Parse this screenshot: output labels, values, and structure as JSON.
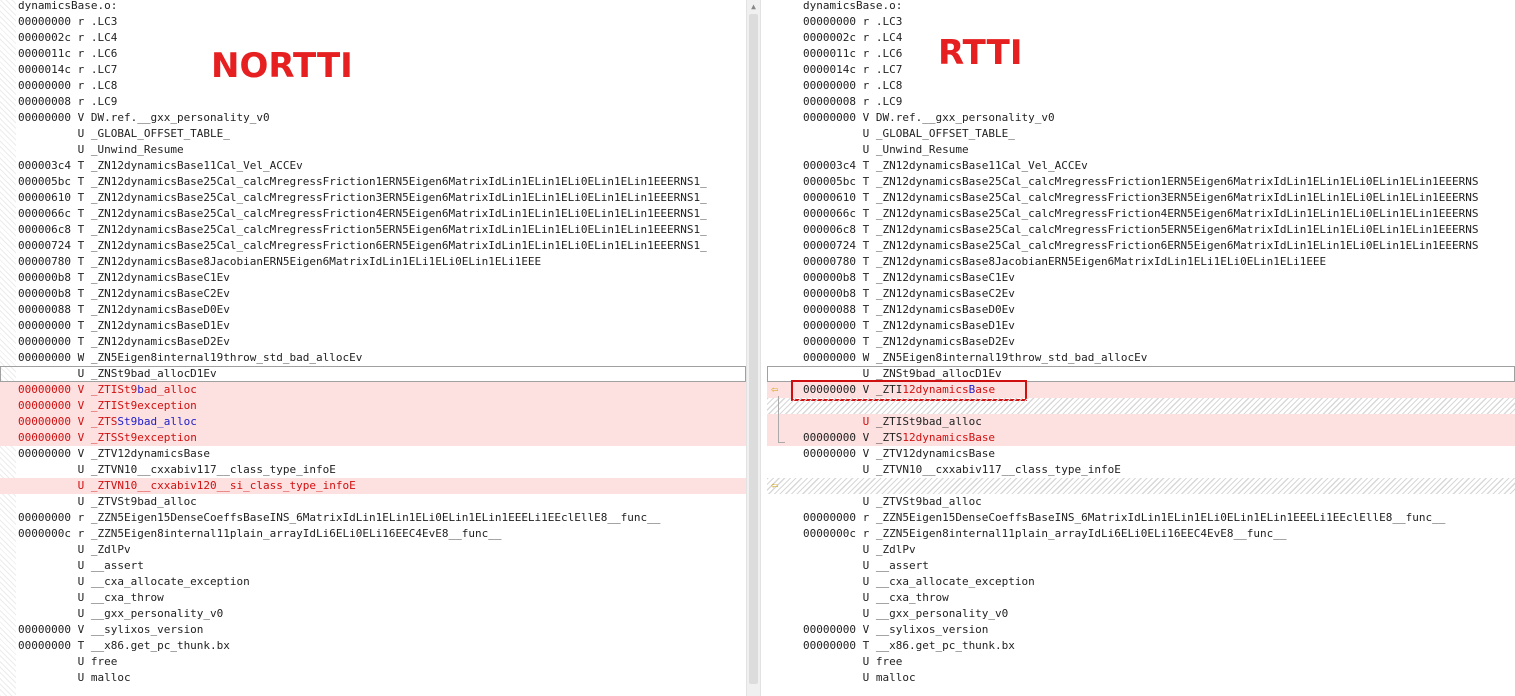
{
  "labels": {
    "left": "NORTTI",
    "right": "RTTI"
  },
  "left_lines": [
    {
      "addr": "dynamicsBase.o:",
      "type": "",
      "sym": "",
      "style": "normal"
    },
    {
      "addr": "00000000",
      "type": "r",
      "sym": ".LC3",
      "style": "normal"
    },
    {
      "addr": "0000002c",
      "type": "r",
      "sym": ".LC4",
      "style": "normal"
    },
    {
      "addr": "0000011c",
      "type": "r",
      "sym": ".LC6",
      "style": "normal"
    },
    {
      "addr": "0000014c",
      "type": "r",
      "sym": ".LC7",
      "style": "normal"
    },
    {
      "addr": "00000000",
      "type": "r",
      "sym": ".LC8",
      "style": "normal"
    },
    {
      "addr": "00000008",
      "type": "r",
      "sym": ".LC9",
      "style": "normal"
    },
    {
      "addr": "00000000",
      "type": "V",
      "sym": "DW.ref.__gxx_personality_v0",
      "style": "normal"
    },
    {
      "addr": "        ",
      "type": "U",
      "sym": "_GLOBAL_OFFSET_TABLE_",
      "style": "normal"
    },
    {
      "addr": "        ",
      "type": "U",
      "sym": "_Unwind_Resume",
      "style": "normal"
    },
    {
      "addr": "000003c4",
      "type": "T",
      "sym": "_ZN12dynamicsBase11Cal_Vel_ACCEv",
      "style": "normal"
    },
    {
      "addr": "000005bc",
      "type": "T",
      "sym": "_ZN12dynamicsBase25Cal_calcMregressFriction1ERN5Eigen6MatrixIdLin1ELin1ELi0ELin1ELin1EEERNS1_",
      "style": "normal"
    },
    {
      "addr": "00000610",
      "type": "T",
      "sym": "_ZN12dynamicsBase25Cal_calcMregressFriction3ERN5Eigen6MatrixIdLin1ELin1ELi0ELin1ELin1EEERNS1_",
      "style": "normal"
    },
    {
      "addr": "0000066c",
      "type": "T",
      "sym": "_ZN12dynamicsBase25Cal_calcMregressFriction4ERN5Eigen6MatrixIdLin1ELin1ELi0ELin1ELin1EEERNS1_",
      "style": "normal"
    },
    {
      "addr": "000006c8",
      "type": "T",
      "sym": "_ZN12dynamicsBase25Cal_calcMregressFriction5ERN5Eigen6MatrixIdLin1ELin1ELi0ELin1ELin1EEERNS1_",
      "style": "normal"
    },
    {
      "addr": "00000724",
      "type": "T",
      "sym": "_ZN12dynamicsBase25Cal_calcMregressFriction6ERN5Eigen6MatrixIdLin1ELin1ELi0ELin1ELin1EEERNS1_",
      "style": "normal"
    },
    {
      "addr": "00000780",
      "type": "T",
      "sym": "_ZN12dynamicsBase8JacobianERN5Eigen6MatrixIdLin1ELi1ELi0ELin1ELi1EEE",
      "style": "normal"
    },
    {
      "addr": "000000b8",
      "type": "T",
      "sym": "_ZN12dynamicsBaseC1Ev",
      "style": "normal"
    },
    {
      "addr": "000000b8",
      "type": "T",
      "sym": "_ZN12dynamicsBaseC2Ev",
      "style": "normal"
    },
    {
      "addr": "00000088",
      "type": "T",
      "sym": "_ZN12dynamicsBaseD0Ev",
      "style": "normal"
    },
    {
      "addr": "00000000",
      "type": "T",
      "sym": "_ZN12dynamicsBaseD1Ev",
      "style": "normal"
    },
    {
      "addr": "00000000",
      "type": "T",
      "sym": "_ZN12dynamicsBaseD2Ev",
      "style": "normal"
    },
    {
      "addr": "00000000",
      "type": "W",
      "sym": "_ZN5Eigen8internal19throw_std_bad_allocEv",
      "style": "normal"
    },
    {
      "addr": "        ",
      "type": "U",
      "sym": "_ZNSt9bad_allocD1Ev",
      "style": "outline"
    },
    {
      "addr": "00000000",
      "type": "V",
      "sym": "_ZTISt9bad_alloc",
      "style": "del"
    },
    {
      "addr": "00000000",
      "type": "V",
      "sym": "_ZTISt9exception",
      "style": "del"
    },
    {
      "addr": "00000000",
      "type": "V",
      "sym": "_ZTSSt9bad_alloc",
      "style": "del"
    },
    {
      "addr": "00000000",
      "type": "V",
      "sym": "_ZTSSt9exception",
      "style": "del"
    },
    {
      "addr": "00000000",
      "type": "V",
      "sym": "_ZTV12dynamicsBase",
      "style": "normal"
    },
    {
      "addr": "        ",
      "type": "U",
      "sym": "_ZTVN10__cxxabiv117__class_type_infoE",
      "style": "normal"
    },
    {
      "addr": "        ",
      "type": "U",
      "sym": "_ZTVN10__cxxabiv120__si_class_type_infoE",
      "style": "del"
    },
    {
      "addr": "        ",
      "type": "U",
      "sym": "_ZTVSt9bad_alloc",
      "style": "normal"
    },
    {
      "addr": "00000000",
      "type": "r",
      "sym": "_ZZN5Eigen15DenseCoeffsBaseINS_6MatrixIdLin1ELin1ELi0ELin1ELin1EEELi1EEclEllE8__func__",
      "style": "normal"
    },
    {
      "addr": "0000000c",
      "type": "r",
      "sym": "_ZZN5Eigen8internal11plain_arrayIdLi6ELi0ELi16EEC4EvE8__func__",
      "style": "normal"
    },
    {
      "addr": "        ",
      "type": "U",
      "sym": "_ZdlPv",
      "style": "normal"
    },
    {
      "addr": "        ",
      "type": "U",
      "sym": "__assert",
      "style": "normal"
    },
    {
      "addr": "        ",
      "type": "U",
      "sym": "__cxa_allocate_exception",
      "style": "normal"
    },
    {
      "addr": "        ",
      "type": "U",
      "sym": "__cxa_throw",
      "style": "normal"
    },
    {
      "addr": "        ",
      "type": "U",
      "sym": "__gxx_personality_v0",
      "style": "normal"
    },
    {
      "addr": "00000000",
      "type": "V",
      "sym": "__sylixos_version",
      "style": "normal"
    },
    {
      "addr": "00000000",
      "type": "T",
      "sym": "__x86.get_pc_thunk.bx",
      "style": "normal"
    },
    {
      "addr": "        ",
      "type": "U",
      "sym": "free",
      "style": "normal"
    },
    {
      "addr": "        ",
      "type": "U",
      "sym": "malloc",
      "style": "normal"
    }
  ],
  "right_lines": [
    {
      "addr": "dynamicsBase.o:",
      "type": "",
      "sym": "",
      "style": "normal"
    },
    {
      "addr": "00000000",
      "type": "r",
      "sym": ".LC3",
      "style": "normal"
    },
    {
      "addr": "0000002c",
      "type": "r",
      "sym": ".LC4",
      "style": "normal"
    },
    {
      "addr": "0000011c",
      "type": "r",
      "sym": ".LC6",
      "style": "normal"
    },
    {
      "addr": "0000014c",
      "type": "r",
      "sym": ".LC7",
      "style": "normal"
    },
    {
      "addr": "00000000",
      "type": "r",
      "sym": ".LC8",
      "style": "normal"
    },
    {
      "addr": "00000008",
      "type": "r",
      "sym": ".LC9",
      "style": "normal"
    },
    {
      "addr": "00000000",
      "type": "V",
      "sym": "DW.ref.__gxx_personality_v0",
      "style": "normal"
    },
    {
      "addr": "        ",
      "type": "U",
      "sym": "_GLOBAL_OFFSET_TABLE_",
      "style": "normal"
    },
    {
      "addr": "        ",
      "type": "U",
      "sym": "_Unwind_Resume",
      "style": "normal"
    },
    {
      "addr": "000003c4",
      "type": "T",
      "sym": "_ZN12dynamicsBase11Cal_Vel_ACCEv",
      "style": "normal"
    },
    {
      "addr": "000005bc",
      "type": "T",
      "sym": "_ZN12dynamicsBase25Cal_calcMregressFriction1ERN5Eigen6MatrixIdLin1ELin1ELi0ELin1ELin1EEERNS",
      "style": "normal"
    },
    {
      "addr": "00000610",
      "type": "T",
      "sym": "_ZN12dynamicsBase25Cal_calcMregressFriction3ERN5Eigen6MatrixIdLin1ELin1ELi0ELin1ELin1EEERNS",
      "style": "normal"
    },
    {
      "addr": "0000066c",
      "type": "T",
      "sym": "_ZN12dynamicsBase25Cal_calcMregressFriction4ERN5Eigen6MatrixIdLin1ELin1ELi0ELin1ELin1EEERNS",
      "style": "normal"
    },
    {
      "addr": "000006c8",
      "type": "T",
      "sym": "_ZN12dynamicsBase25Cal_calcMregressFriction5ERN5Eigen6MatrixIdLin1ELin1ELi0ELin1ELin1EEERNS",
      "style": "normal"
    },
    {
      "addr": "00000724",
      "type": "T",
      "sym": "_ZN12dynamicsBase25Cal_calcMregressFriction6ERN5Eigen6MatrixIdLin1ELin1ELi0ELin1ELin1EEERNS",
      "style": "normal"
    },
    {
      "addr": "00000780",
      "type": "T",
      "sym": "_ZN12dynamicsBase8JacobianERN5Eigen6MatrixIdLin1ELi1ELi0ELin1ELi1EEE",
      "style": "normal"
    },
    {
      "addr": "000000b8",
      "type": "T",
      "sym": "_ZN12dynamicsBaseC1Ev",
      "style": "normal"
    },
    {
      "addr": "000000b8",
      "type": "T",
      "sym": "_ZN12dynamicsBaseC2Ev",
      "style": "normal"
    },
    {
      "addr": "00000088",
      "type": "T",
      "sym": "_ZN12dynamicsBaseD0Ev",
      "style": "normal"
    },
    {
      "addr": "00000000",
      "type": "T",
      "sym": "_ZN12dynamicsBaseD1Ev",
      "style": "normal"
    },
    {
      "addr": "00000000",
      "type": "T",
      "sym": "_ZN12dynamicsBaseD2Ev",
      "style": "normal"
    },
    {
      "addr": "00000000",
      "type": "W",
      "sym": "_ZN5Eigen8internal19throw_std_bad_allocEv",
      "style": "normal"
    },
    {
      "addr": "        ",
      "type": "U",
      "sym": "_ZNSt9bad_allocD1Ev",
      "style": "outline"
    },
    {
      "addr": "00000000",
      "type": "V",
      "sym": "_ZTI12dynamicsBase",
      "style": "ins-box"
    },
    {
      "addr": "",
      "type": "",
      "sym": "",
      "style": "filler"
    },
    {
      "addr": "        ",
      "type": "U",
      "sym": "_ZTISt9bad_alloc",
      "style": "ins-u"
    },
    {
      "addr": "00000000",
      "type": "V",
      "sym": "_ZTS12dynamicsBase",
      "style": "ins"
    },
    {
      "addr": "00000000",
      "type": "V",
      "sym": "_ZTV12dynamicsBase",
      "style": "normal"
    },
    {
      "addr": "        ",
      "type": "U",
      "sym": "_ZTVN10__cxxabiv117__class_type_infoE",
      "style": "normal"
    },
    {
      "addr": "",
      "type": "",
      "sym": "",
      "style": "filler"
    },
    {
      "addr": "        ",
      "type": "U",
      "sym": "_ZTVSt9bad_alloc",
      "style": "normal"
    },
    {
      "addr": "00000000",
      "type": "r",
      "sym": "_ZZN5Eigen15DenseCoeffsBaseINS_6MatrixIdLin1ELin1ELi0ELin1ELin1EEELi1EEclEllE8__func__",
      "style": "normal"
    },
    {
      "addr": "0000000c",
      "type": "r",
      "sym": "_ZZN5Eigen8internal11plain_arrayIdLi6ELi0ELi16EEC4EvE8__func__",
      "style": "normal"
    },
    {
      "addr": "        ",
      "type": "U",
      "sym": "_ZdlPv",
      "style": "normal"
    },
    {
      "addr": "        ",
      "type": "U",
      "sym": "__assert",
      "style": "normal"
    },
    {
      "addr": "        ",
      "type": "U",
      "sym": "__cxa_allocate_exception",
      "style": "normal"
    },
    {
      "addr": "        ",
      "type": "U",
      "sym": "__cxa_throw",
      "style": "normal"
    },
    {
      "addr": "        ",
      "type": "U",
      "sym": "__gxx_personality_v0",
      "style": "normal"
    },
    {
      "addr": "00000000",
      "type": "V",
      "sym": "__sylixos_version",
      "style": "normal"
    },
    {
      "addr": "00000000",
      "type": "T",
      "sym": "__x86.get_pc_thunk.bx",
      "style": "normal"
    },
    {
      "addr": "        ",
      "type": "U",
      "sym": "free",
      "style": "normal"
    },
    {
      "addr": "        ",
      "type": "U",
      "sym": "malloc",
      "style": "normal"
    }
  ],
  "colors": {
    "deleted_bg": "#fde1e1",
    "deleted_text": "#d01010",
    "highlight_box": "#d01010",
    "label_text": "#e62020",
    "arrow": "#d4a000"
  },
  "icons": {
    "diff_arrow": "left-arrow-icon",
    "scroll_up": "scroll-up-arrow-icon"
  }
}
